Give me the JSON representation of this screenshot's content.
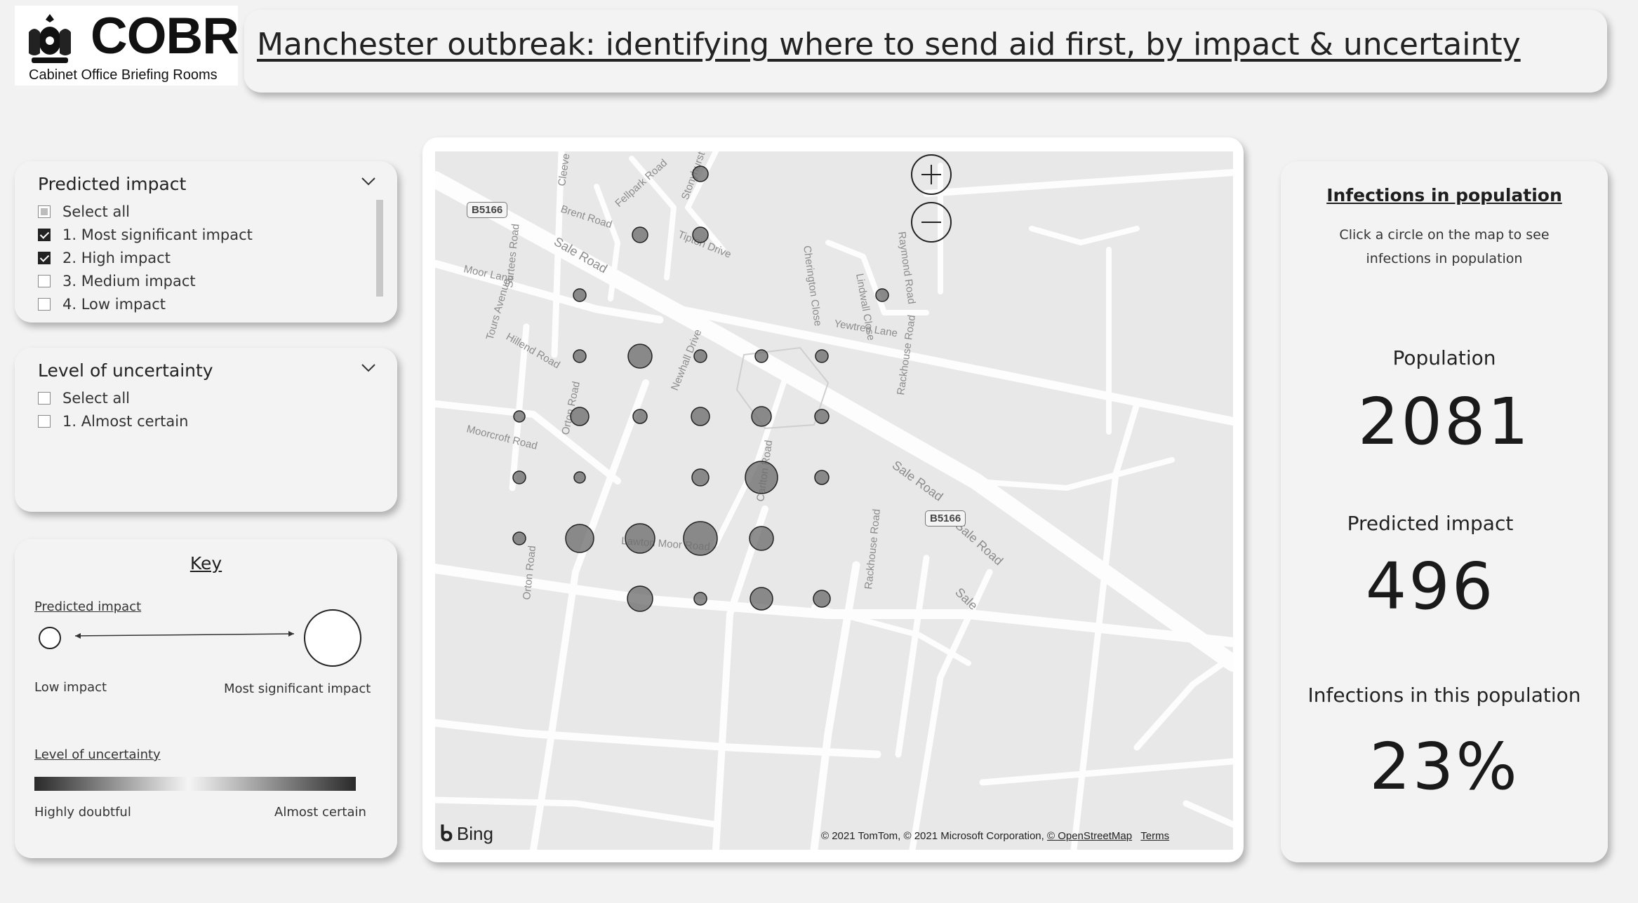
{
  "logo": {
    "text": "COBR",
    "subtitle": "Cabinet Office Briefing Rooms"
  },
  "title": "Manchester outbreak: identifying where to send aid first, by impact & uncertainty",
  "impact_slicer": {
    "header": "Predicted impact",
    "options": [
      {
        "label": "Select all",
        "state": "partial"
      },
      {
        "label": "1. Most significant impact",
        "state": "checked"
      },
      {
        "label": "2. High impact",
        "state": "checked"
      },
      {
        "label": "3. Medium impact",
        "state": "unchecked"
      },
      {
        "label": "4. Low impact",
        "state": "unchecked"
      }
    ]
  },
  "uncertainty_slicer": {
    "header": "Level of uncertainty",
    "options": [
      {
        "label": "Select all",
        "state": "unchecked"
      },
      {
        "label": "1. Almost certain",
        "state": "unchecked"
      }
    ]
  },
  "key": {
    "title": "Key",
    "impact_heading": "Predicted impact",
    "impact_low": "Low impact",
    "impact_high": "Most significant impact",
    "uncertainty_heading": "Level of uncertainty",
    "uncertainty_low": "Highly doubtful",
    "uncertainty_high": "Almost certain"
  },
  "map": {
    "streets": [
      "Brent Road",
      "Fellpark Road",
      "Sale Road",
      "Moor Lane",
      "Surtees Road",
      "Tours Avenue",
      "Hillend Road",
      "Newhall Drive",
      "Cherington Close",
      "Lindwall Close",
      "Raymond Road",
      "Yewtree Lane",
      "Rackhouse Road",
      "Moorcroft Road",
      "Orton Road",
      "Carlton Road",
      "Lawton Moor Road",
      "Cleeve Road",
      "Stonyhurst Drive",
      "Tipton Drive",
      "Sale"
    ],
    "road_shield": "B5166",
    "provider": "Bing",
    "attribution": "© 2021 TomTom, © 2021 Microsoft Corporation,",
    "osm": "© OpenStreetMap",
    "terms": "Terms",
    "zoom_in": "+",
    "zoom_out": "−"
  },
  "info": {
    "title": "Infections in population",
    "description": "Click a circle on the map to see infections in population",
    "population_label": "Population",
    "population_value": "2081",
    "impact_label": "Predicted impact",
    "impact_value": "496",
    "infections_label": "Infections in this population",
    "infections_value": "23%"
  }
}
